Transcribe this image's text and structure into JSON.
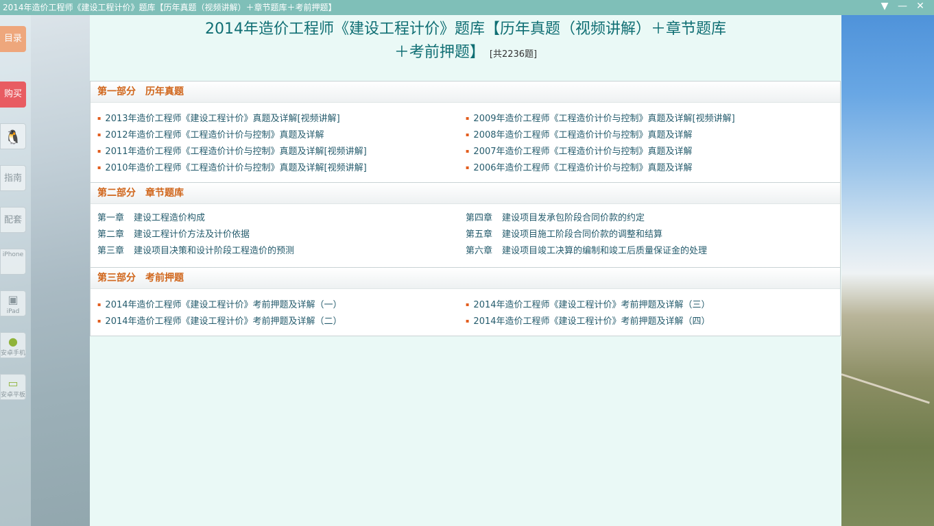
{
  "window": {
    "title": "2014年造价工程师《建设工程计价》题库【历年真题（视频讲解）＋章节题库＋考前押题】",
    "controls": [
      "▼",
      "—",
      "✕"
    ]
  },
  "sidebar": {
    "catalog": "目录",
    "buy": "购买",
    "guide": "指南",
    "config": "配套",
    "iphone": "iPhone",
    "ipad": "iPad",
    "android_phone": "安卓手机",
    "android_tablet": "安卓平板"
  },
  "heading": {
    "line1": "2014年造价工程师《建设工程计价》题库【历年真题（视频讲解）＋章节题库",
    "line2": "＋考前押题】",
    "count": "[共2236题]"
  },
  "sections": [
    {
      "part": "第一部分",
      "name": "历年真题",
      "left": [
        "2013年造价工程师《建设工程计价》真题及详解[视频讲解]",
        "2012年造价工程师《工程造价计价与控制》真题及详解",
        "2011年造价工程师《工程造价计价与控制》真题及详解[视频讲解]",
        "2010年造价工程师《工程造价计价与控制》真题及详解[视频讲解]"
      ],
      "right": [
        "2009年造价工程师《工程造价计价与控制》真题及详解[视频讲解]",
        "2008年造价工程师《工程造价计价与控制》真题及详解",
        "2007年造价工程师《工程造价计价与控制》真题及详解",
        "2006年造价工程师《工程造价计价与控制》真题及详解"
      ]
    },
    {
      "part": "第二部分",
      "name": "章节题库",
      "left": [
        {
          "num": "第一章",
          "title": "建设工程造价构成"
        },
        {
          "num": "第二章",
          "title": "建设工程计价方法及计价依据"
        },
        {
          "num": "第三章",
          "title": "建设项目决策和设计阶段工程造价的预测"
        }
      ],
      "right": [
        {
          "num": "第四章",
          "title": "建设项目发承包阶段合同价款的约定"
        },
        {
          "num": "第五章",
          "title": "建设项目施工阶段合同价款的调整和结算"
        },
        {
          "num": "第六章",
          "title": "建设项目竣工决算的编制和竣工后质量保证金的处理"
        }
      ]
    },
    {
      "part": "第三部分",
      "name": "考前押题",
      "left": [
        "2014年造价工程师《建设工程计价》考前押题及详解（一）",
        "2014年造价工程师《建设工程计价》考前押题及详解（二）"
      ],
      "right": [
        "2014年造价工程师《建设工程计价》考前押题及详解（三）",
        "2014年造价工程师《建设工程计价》考前押题及详解（四）"
      ]
    }
  ]
}
